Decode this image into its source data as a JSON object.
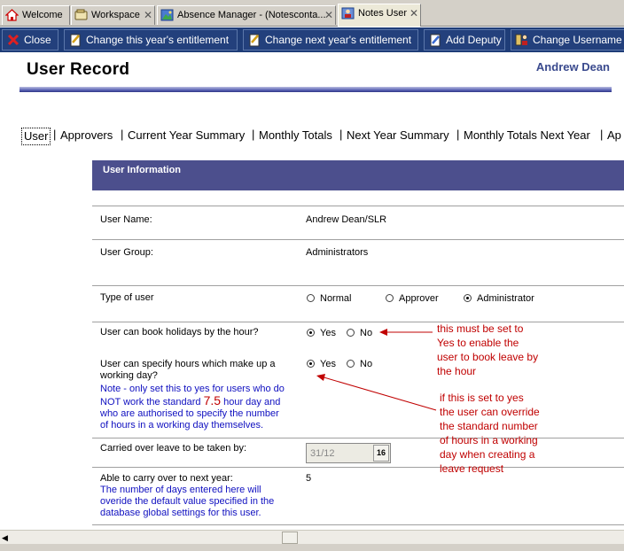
{
  "window_tabs": [
    {
      "label": "Welcome",
      "icon": "home-icon",
      "closable": false
    },
    {
      "label": "Workspace",
      "icon": "workspace-icon",
      "closable": true
    },
    {
      "label": "Absence Manager - (Notesconta...",
      "icon": "database-icon",
      "closable": true
    },
    {
      "label": "Notes User",
      "icon": "user-doc-icon",
      "closable": true
    }
  ],
  "tab_close_glyph": "✕",
  "action_bar": {
    "close": "Close",
    "change_this_year": "Change this year's entitlement",
    "change_next_year": "Change next year's entitlement",
    "add_deputy": "Add Deputy",
    "change_username": "Change Username"
  },
  "header": {
    "title": "User Record",
    "user": "Andrew Dean"
  },
  "doc_tabs": [
    "User",
    "Approvers",
    "Current Year Summary",
    "Monthly Totals",
    "Next Year Summary",
    "Monthly Totals Next Year",
    "Ap"
  ],
  "doc_tab_separator": "|",
  "form": {
    "section_title": "User Information",
    "user_name_label": "User Name:",
    "user_name_value": "Andrew Dean/SLR",
    "user_group_label": "User Group:",
    "user_group_value": "Administrators",
    "type_label": "Type of user",
    "type_options": [
      "Normal",
      "Approver",
      "Administrator"
    ],
    "type_selected": "Administrator",
    "book_hours_label": "User can book holidays by the hour?",
    "book_hours_options": [
      "Yes",
      "No"
    ],
    "book_hours_selected": "Yes",
    "specify_hours_label_1": "User can specify hours which make up a",
    "specify_hours_label_2": "working day?",
    "specify_hours_note_1": "Note - only set this to yes for users who do",
    "specify_hours_note_2a": "NOT work the standard ",
    "specify_hours_note_2b": "7.5",
    "specify_hours_note_2c": " hour day and",
    "specify_hours_note_3": "who are authorised to specify the number",
    "specify_hours_note_4": "of hours in a working day themselves.",
    "specify_hours_options": [
      "Yes",
      "No"
    ],
    "specify_hours_selected": "Yes",
    "carried_over_label": "Carried over leave to be taken by:",
    "carried_over_value": "31/12",
    "calendar_button": "16",
    "carry_next_label": "Able to carry over to next year:",
    "carry_next_value": "5",
    "carry_next_note_1": "The number of days entered here will",
    "carry_next_note_2": "overide the default value specified in the",
    "carry_next_note_3": "database global settings for this user."
  },
  "annotations": {
    "first": [
      "this must be set to",
      "Yes to enable the",
      "user to book leave by",
      "the hour"
    ],
    "second": [
      "if this is set to yes",
      "the user can override",
      "the standard number",
      "of hours in a working",
      "day when creating a",
      "leave request"
    ]
  },
  "colors": {
    "action_bar": "#1f3d78",
    "section_bar": "#4c4f8d",
    "note_text": "#1010c0",
    "annotation": "#c00000"
  }
}
